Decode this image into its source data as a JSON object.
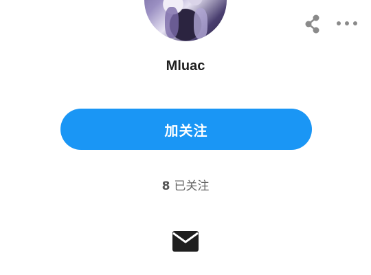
{
  "profile": {
    "username": "Mluac",
    "follow_label": "加关注",
    "following_count": "8",
    "following_label": "已关注"
  },
  "icons": {
    "share": "share-icon",
    "more": "more-dots-icon",
    "mail": "envelope-icon"
  },
  "colors": {
    "accent": "#1a96f5",
    "icon_gray": "#8a8a8a",
    "text_dark": "#1f1f1f"
  }
}
